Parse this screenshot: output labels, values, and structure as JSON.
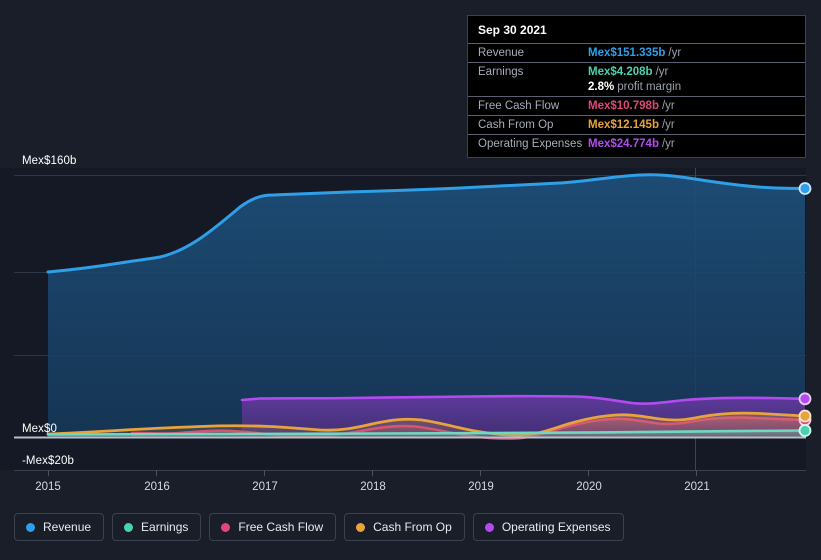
{
  "theme": {
    "background": "#191e29",
    "plot_background": "#141925",
    "gridline": "#2f3644",
    "axis_text": "#ffffff"
  },
  "tooltip": {
    "date": "Sep 30 2021",
    "rows": [
      {
        "key": "Revenue",
        "value": "Mex$151.335b",
        "unit": "/yr",
        "color": "#2f9fe8"
      },
      {
        "key": "Earnings",
        "value": "Mex$4.208b",
        "unit": "/yr",
        "color": "#4ad2b0"
      },
      {
        "key": "",
        "value": "2.8%",
        "unit": "profit margin",
        "color": "#ffffff",
        "sub": true
      },
      {
        "key": "Free Cash Flow",
        "value": "Mex$10.798b",
        "unit": "/yr",
        "color": "#e0467c"
      },
      {
        "key": "Cash From Op",
        "value": "Mex$12.145b",
        "unit": "/yr",
        "color": "#e8a33d"
      },
      {
        "key": "Operating Expenses",
        "value": "Mex$24.774b",
        "unit": "/yr",
        "color": "#b44bf0"
      }
    ]
  },
  "legend": {
    "items": [
      {
        "label": "Revenue",
        "color": "#2f9fe8"
      },
      {
        "label": "Earnings",
        "color": "#4ad2b0"
      },
      {
        "label": "Free Cash Flow",
        "color": "#e0467c"
      },
      {
        "label": "Cash From Op",
        "color": "#e8a33d"
      },
      {
        "label": "Operating Expenses",
        "color": "#b44bf0"
      }
    ]
  },
  "chart_data": {
    "type": "area",
    "title": "",
    "xlabel": "",
    "ylabel": "",
    "currency": "Mex$",
    "y_axis_labels": [
      "Mex$160b",
      "Mex$0",
      "-Mex$20b"
    ],
    "ylim": [
      -20,
      160
    ],
    "gridlines": [
      160,
      100,
      50,
      0
    ],
    "grid": true,
    "legend_position": "bottom",
    "x_tick_labels": [
      "2015",
      "2016",
      "2017",
      "2018",
      "2019",
      "2020",
      "2021"
    ],
    "x": [
      2015.0,
      2015.25,
      2015.5,
      2015.75,
      2016.0,
      2016.25,
      2016.5,
      2016.75,
      2017.0,
      2017.25,
      2017.5,
      2017.75,
      2018.0,
      2018.25,
      2018.5,
      2018.75,
      2019.0,
      2019.25,
      2019.5,
      2019.75,
      2020.0,
      2020.25,
      2020.5,
      2020.75,
      2021.0,
      2021.25,
      2021.5,
      2021.75
    ],
    "series": [
      {
        "name": "Revenue",
        "color": "#2f9fe8",
        "values": [
          101,
          103,
          105,
          107,
          109,
          116,
          126,
          136,
          145,
          147,
          148,
          148,
          149,
          150,
          150,
          151,
          151,
          152,
          153,
          155,
          158,
          159,
          158,
          157,
          156,
          154,
          152,
          151.335
        ]
      },
      {
        "name": "Earnings",
        "color": "#4ad2b0",
        "values": [
          2.0,
          2.1,
          2.2,
          2.2,
          2.3,
          2.3,
          2.4,
          2.5,
          2.6,
          2.6,
          2.6,
          2.7,
          2.7,
          2.8,
          2.9,
          3.0,
          3.0,
          2.9,
          2.8,
          2.9,
          3.1,
          3.3,
          3.5,
          3.8,
          4.0,
          4.1,
          4.15,
          4.208
        ]
      },
      {
        "name": "Free Cash Flow",
        "color": "#e0467c",
        "values": [
          null,
          null,
          null,
          null,
          1.0,
          0.9,
          1.2,
          2.0,
          2.5,
          1.8,
          1.2,
          1.5,
          2.5,
          4.0,
          5.5,
          5.0,
          3.5,
          2.0,
          1.0,
          0.5,
          2.0,
          5.5,
          8.5,
          9.0,
          7.0,
          8.5,
          10.5,
          10.798
        ]
      },
      {
        "name": "Cash From Op",
        "color": "#e8a33d",
        "values": [
          3.0,
          3.4,
          4.0,
          4.5,
          5.0,
          5.5,
          6.0,
          6.5,
          6.8,
          6.5,
          6.0,
          5.8,
          6.5,
          8.0,
          9.0,
          8.5,
          7.0,
          5.5,
          4.0,
          3.5,
          5.0,
          8.0,
          10.5,
          11.0,
          9.5,
          10.5,
          12.0,
          12.145
        ]
      },
      {
        "name": "Operating Expenses",
        "color": "#b44bf0",
        "values": [
          null,
          null,
          null,
          null,
          null,
          null,
          null,
          23.5,
          24.0,
          24.2,
          24.0,
          23.8,
          24.0,
          24.3,
          24.5,
          24.4,
          24.2,
          24.3,
          24.5,
          24.6,
          24.5,
          24.0,
          23.2,
          23.0,
          23.5,
          24.2,
          24.6,
          24.774
        ]
      }
    ],
    "cursor_x_label": "Sep 30 2021"
  }
}
